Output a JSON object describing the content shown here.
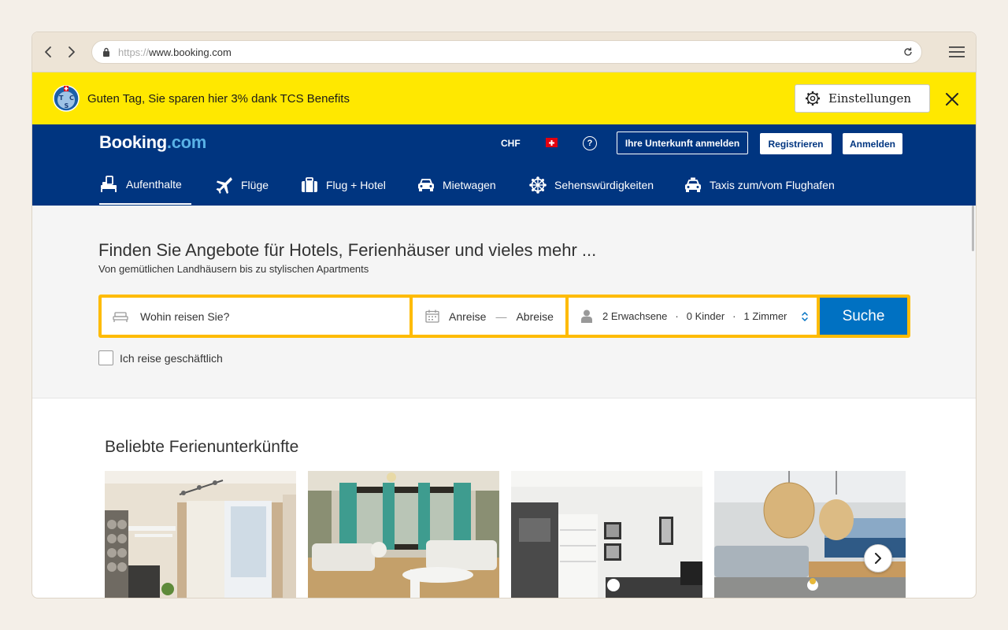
{
  "browser": {
    "url_protocol": "https://",
    "url_host": "www.booking.com"
  },
  "banner": {
    "text": "Guten Tag, Sie sparen hier 3% dank TCS Benefits",
    "settings_label": "Einstellungen",
    "logo_letters": [
      "T",
      "C",
      "S"
    ]
  },
  "header": {
    "logo_main": "Booking",
    "logo_suffix": ".com",
    "currency": "CHF",
    "help_symbol": "?",
    "list_property": "Ihre Unterkunft anmelden",
    "register": "Registrieren",
    "signin": "Anmelden",
    "tabs": [
      {
        "label": "Aufenthalte",
        "icon": "bed-icon"
      },
      {
        "label": "Flüge",
        "icon": "plane-icon"
      },
      {
        "label": "Flug + Hotel",
        "icon": "suitcase-icon"
      },
      {
        "label": "Mietwagen",
        "icon": "car-icon"
      },
      {
        "label": "Sehenswürdigkeiten",
        "icon": "attractions-icon"
      },
      {
        "label": "Taxis zum/vom Flughafen",
        "icon": "taxi-icon"
      }
    ]
  },
  "hero": {
    "title": "Finden Sie Angebote für Hotels, Ferienhäuser und vieles mehr ...",
    "subtitle": "Von gemütlichen Landhäusern bis zu stylischen Apartments",
    "destination_placeholder": "Wohin reisen Sie?",
    "checkin": "Anreise",
    "date_separator": "—",
    "checkout": "Abreise",
    "adults": "2 Erwachsene",
    "children": "0 Kinder",
    "rooms": "1 Zimmer",
    "guest_separator": "·",
    "search_label": "Suche",
    "business_label": "Ich reise geschäftlich"
  },
  "popular": {
    "title": "Beliebte Ferienunterkünfte"
  },
  "colors": {
    "brand_blue": "#003580",
    "search_blue": "#0071c2",
    "search_border": "#febb02",
    "banner_yellow": "#ffe800",
    "logo_accent": "#59b1e6"
  }
}
